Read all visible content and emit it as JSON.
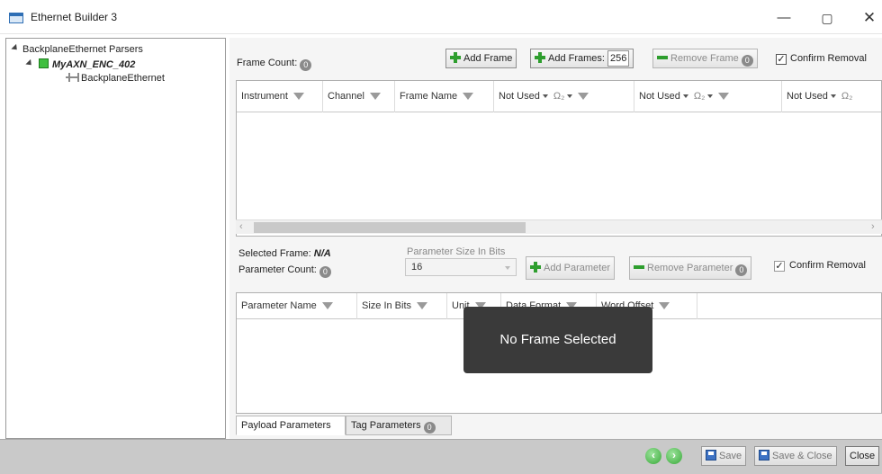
{
  "window": {
    "title": "Ethernet Builder 3",
    "minimize_glyph": "—",
    "maximize_glyph": "▢",
    "close_glyph": "✕"
  },
  "tree": {
    "root_label": "BackplaneEthernet Parsers",
    "child_label": "MyAXN_ENC_402",
    "leaf_label": "BackplaneEthernet"
  },
  "frames": {
    "count_label": "Frame Count:",
    "count_value": "0",
    "add_frame_label": "Add Frame",
    "add_frames_label": "Add Frames:",
    "add_frames_value": "256",
    "remove_frame_label": "Remove Frame",
    "remove_frame_count": "0",
    "confirm_removal_label": "Confirm Removal",
    "confirm_removal_checked": "✓",
    "columns": {
      "instrument": "Instrument",
      "channel": "Channel",
      "frame_name": "Frame Name",
      "not_used_1": "Not Used",
      "omega_1": "Ω₂",
      "not_used_2": "Not Used",
      "omega_2": "Ω₂",
      "not_used_3": "Not Used",
      "omega_3": "Ω₂"
    },
    "scroll_left": "‹",
    "scroll_right": "›"
  },
  "parameters": {
    "selected_frame_label": "Selected Frame:",
    "selected_frame_value": "N/A",
    "parameter_count_label": "Parameter Count:",
    "parameter_count_value": "0",
    "size_bits_label": "Parameter Size In Bits",
    "size_bits_value": "16",
    "add_parameter_label": "Add Parameter",
    "remove_parameter_label": "Remove Parameter",
    "remove_parameter_count": "0",
    "confirm_removal_label": "Confirm Removal",
    "confirm_removal_checked": "✓",
    "columns": {
      "parameter_name": "Parameter Name",
      "size_in_bits": "Size In Bits",
      "unit": "Unit",
      "data_format": "Data Format",
      "word_offset": "Word Offset"
    },
    "no_frame_message": "No Frame Selected"
  },
  "tabs": {
    "payload": "Payload Parameters",
    "tag": "Tag Parameters",
    "tag_count": "0"
  },
  "footer": {
    "back_glyph": "‹",
    "forward_glyph": "›",
    "save_label": "Save",
    "save_close_label": "Save & Close",
    "close_label": "Close"
  }
}
